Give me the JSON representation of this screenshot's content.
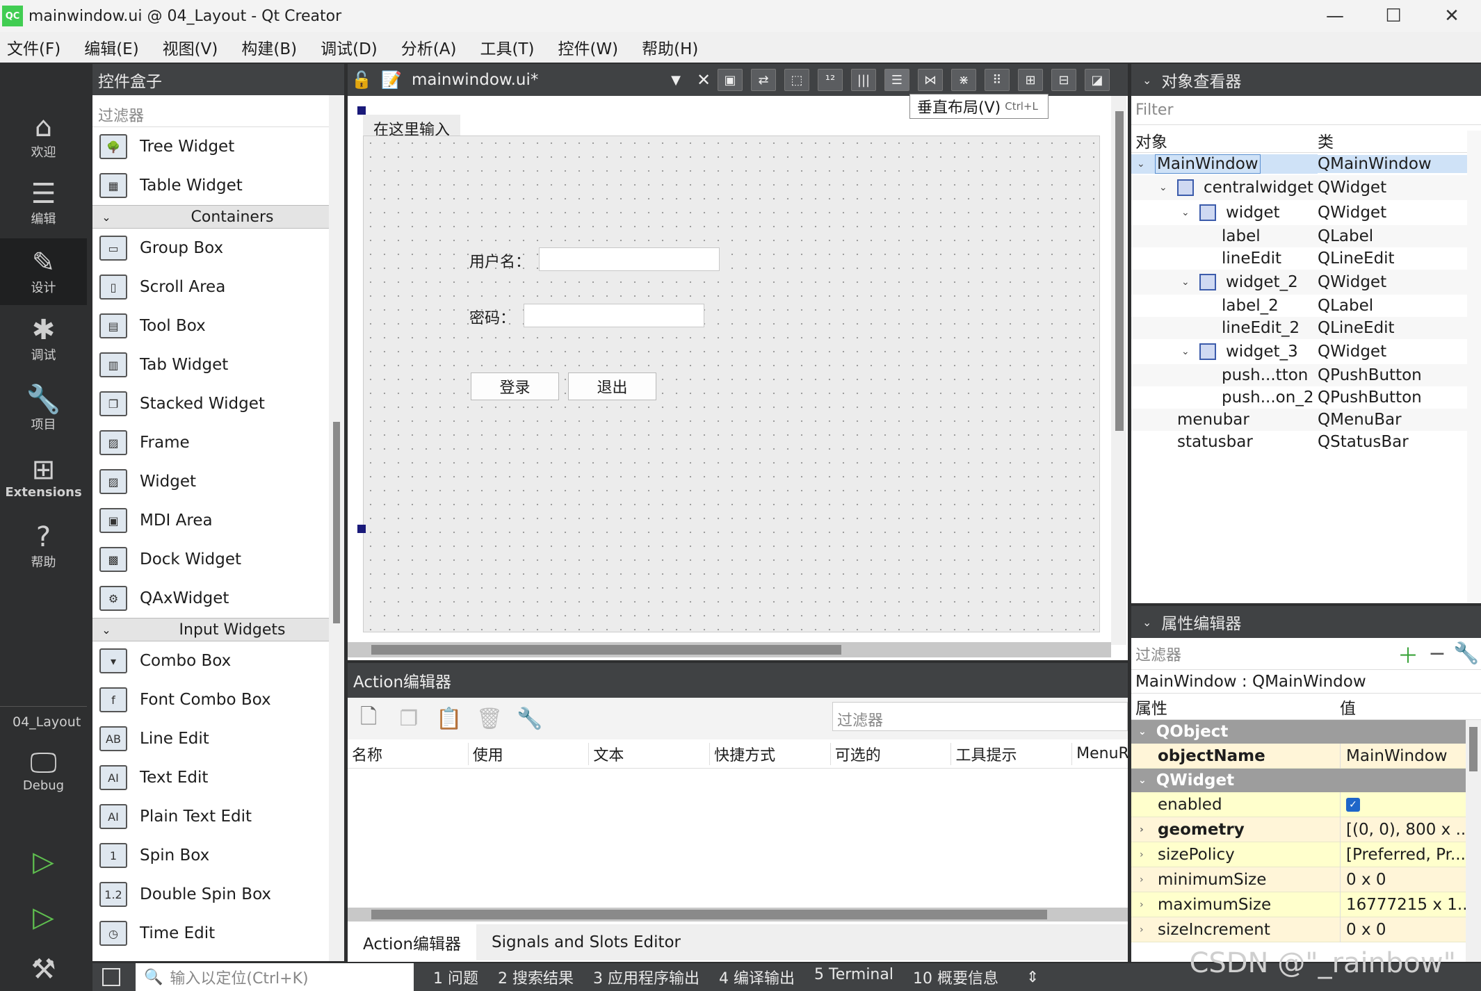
{
  "window": {
    "app_icon": "QC",
    "title": "mainwindow.ui @ 04_Layout - Qt Creator",
    "minimize": "—",
    "maximize": "☐",
    "close": "✕"
  },
  "menu": [
    "文件(F)",
    "编辑(E)",
    "视图(V)",
    "构建(B)",
    "调试(D)",
    "分析(A)",
    "工具(T)",
    "控件(W)",
    "帮助(H)"
  ],
  "modes": {
    "welcome": "欢迎",
    "edit": "编辑",
    "design": "设计",
    "debug": "调试",
    "projects": "项目",
    "extensions": "Extensions",
    "help": "帮助",
    "project_name": "04_Layout",
    "debug_kit": "Debug"
  },
  "widgetbox": {
    "title": "控件盒子",
    "filter": "过滤器",
    "top_items": [
      {
        "label": "Tree Widget",
        "icon": "🌳"
      },
      {
        "label": "Table Widget",
        "icon": "▦"
      }
    ],
    "containers_title": "Containers",
    "containers": [
      {
        "label": "Group Box",
        "icon": "▭"
      },
      {
        "label": "Scroll Area",
        "icon": "▯"
      },
      {
        "label": "Tool Box",
        "icon": "▤"
      },
      {
        "label": "Tab Widget",
        "icon": "▥"
      },
      {
        "label": "Stacked Widget",
        "icon": "❐"
      },
      {
        "label": "Frame",
        "icon": "▨"
      },
      {
        "label": "Widget",
        "icon": "▨"
      },
      {
        "label": "MDI Area",
        "icon": "▣"
      },
      {
        "label": "Dock Widget",
        "icon": "▩"
      },
      {
        "label": "QAxWidget",
        "icon": "⚙"
      }
    ],
    "input_title": "Input Widgets",
    "inputs": [
      {
        "label": "Combo Box",
        "icon": "▾"
      },
      {
        "label": "Font Combo Box",
        "icon": "f"
      },
      {
        "label": "Line Edit",
        "icon": "AB"
      },
      {
        "label": "Text Edit",
        "icon": "AI"
      },
      {
        "label": "Plain Text Edit",
        "icon": "AI"
      },
      {
        "label": "Spin Box",
        "icon": "1"
      },
      {
        "label": "Double Spin Box",
        "icon": "1.2"
      },
      {
        "label": "Time Edit",
        "icon": "◷"
      }
    ]
  },
  "editor": {
    "filename": "mainwindow.ui*",
    "type_here": "在这里输入",
    "tooltip_label": "垂直布局(V)",
    "tooltip_shortcut": "Ctrl+L",
    "username_label": "用户名：",
    "password_label": "密码：",
    "login_button": "登录",
    "exit_button": "退出"
  },
  "action_editor": {
    "title": "Action编辑器",
    "filter": "过滤器",
    "columns": [
      "名称",
      "使用",
      "文本",
      "快捷方式",
      "可选的",
      "工具提示",
      "MenuR"
    ],
    "tabs": [
      "Action编辑器",
      "Signals and Slots Editor"
    ]
  },
  "object_inspector": {
    "title": "对象查看器",
    "filter": "Filter",
    "col_object": "对象",
    "col_class": "类",
    "rows": [
      {
        "name": "MainWindow",
        "cls": "QMainWindow"
      },
      {
        "name": "centralwidget",
        "cls": "QWidget"
      },
      {
        "name": "widget",
        "cls": "QWidget"
      },
      {
        "name": "label",
        "cls": "QLabel"
      },
      {
        "name": "lineEdit",
        "cls": "QLineEdit"
      },
      {
        "name": "widget_2",
        "cls": "QWidget"
      },
      {
        "name": "label_2",
        "cls": "QLabel"
      },
      {
        "name": "lineEdit_2",
        "cls": "QLineEdit"
      },
      {
        "name": "widget_3",
        "cls": "QWidget"
      },
      {
        "name": "push...tton",
        "cls": "QPushButton"
      },
      {
        "name": "push...on_2",
        "cls": "QPushButton"
      },
      {
        "name": "menubar",
        "cls": "QMenuBar"
      },
      {
        "name": "statusbar",
        "cls": "QStatusBar"
      }
    ]
  },
  "property_editor": {
    "title": "属性编辑器",
    "filter": "过滤器",
    "class_line": "MainWindow : QMainWindow",
    "col_prop": "属性",
    "col_value": "值",
    "group1": "QObject",
    "objectName": {
      "name": "objectName",
      "value": "MainWindow"
    },
    "group2": "QWidget",
    "rows": [
      {
        "name": "enabled",
        "value": ""
      },
      {
        "name": "geometry",
        "value": "[(0, 0), 800 x ..."
      },
      {
        "name": "sizePolicy",
        "value": "[Preferred, Pr..."
      },
      {
        "name": "minimumSize",
        "value": "0 x 0"
      },
      {
        "name": "maximumSize",
        "value": "16777215 x 1..."
      },
      {
        "name": "sizeIncrement",
        "value": "0 x 0"
      }
    ]
  },
  "statusbar": {
    "locate_placeholder": "输入以定位(Ctrl+K)",
    "tabs": [
      "1  问题",
      "2  搜索结果",
      "3  应用程序输出",
      "4  编译输出",
      "5  Terminal",
      "10  概要信息"
    ]
  },
  "watermark": "CSDN @\"_rainbow\""
}
